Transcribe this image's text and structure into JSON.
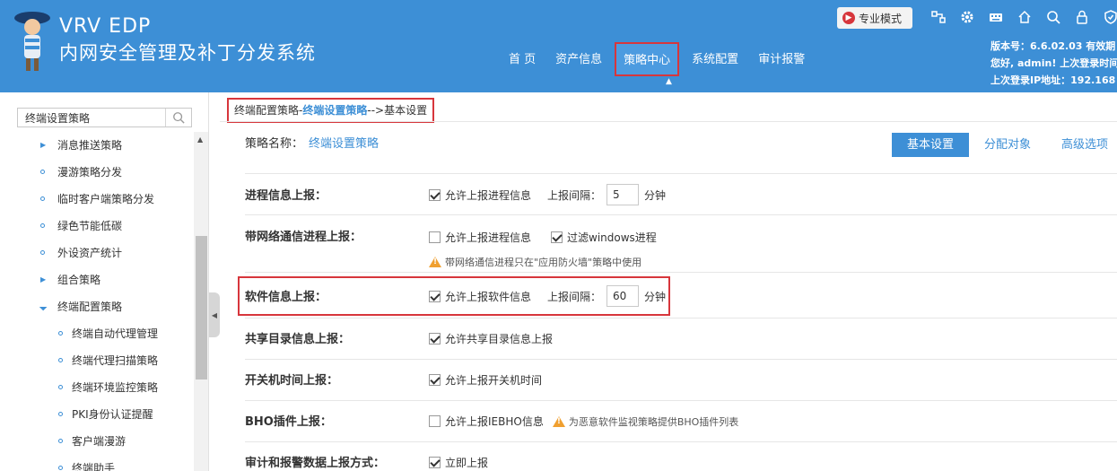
{
  "header": {
    "brand_line1": "VRV EDP",
    "brand_line2": "内网安全管理及补丁分发系统",
    "nav": [
      "首 页",
      "资产信息",
      "策略中心",
      "系统配置",
      "审计报警"
    ],
    "active_nav": "策略中心",
    "pro_mode_label": "专业模式",
    "icons": [
      "network-icon",
      "gear-icon",
      "keyboard-icon",
      "home-icon",
      "search-icon",
      "lock-icon",
      "shield-icon"
    ],
    "version_line": "版本号：6.6.02.03  有效期",
    "greeting_line": "您好, admin! 上次登录时间",
    "last_ip_line": "上次登录IP地址：192.168"
  },
  "sidebar": {
    "search_value": "终端设置策略",
    "items": [
      {
        "label": "消息推送策略",
        "marker": "arrow"
      },
      {
        "label": "漫游策略分发",
        "marker": "circle"
      },
      {
        "label": "临时客户端策略分发",
        "marker": "circle"
      },
      {
        "label": "绿色节能低碳",
        "marker": "circle"
      },
      {
        "label": "外设资产统计",
        "marker": "circle"
      },
      {
        "label": "组合策略",
        "marker": "arrow"
      },
      {
        "label": "终端配置策略",
        "marker": "open"
      },
      {
        "label": "终端自动代理管理",
        "marker": "circle"
      },
      {
        "label": "终端代理扫描策略",
        "marker": "circle"
      },
      {
        "label": "终端环境监控策略",
        "marker": "circle"
      },
      {
        "label": "PKI身份认证提醒",
        "marker": "circle"
      },
      {
        "label": "客户端漫游",
        "marker": "circle"
      },
      {
        "label": "终端助手",
        "marker": "circle"
      }
    ]
  },
  "breadcrumb": {
    "part1": "终端配置策略-",
    "current": "终端设置策略",
    "part3": "-->基本设置"
  },
  "policy": {
    "name_label": "策略名称：",
    "name_value": "终端设置策略"
  },
  "tabs": [
    "基本设置",
    "分配对象",
    "高级选项"
  ],
  "rows": {
    "process": {
      "label": "进程信息上报：",
      "checkbox": "允许上报进程信息",
      "checked": true,
      "interval_label": "上报间隔：",
      "interval_value": "5",
      "unit": "分钟"
    },
    "netproc": {
      "label": "带网络通信进程上报：",
      "checkbox1": "允许上报进程信息",
      "checked1": false,
      "checkbox2": "过滤windows进程",
      "checked2": true,
      "warning": "带网络通信进程只在\"应用防火墙\"策略中使用"
    },
    "software": {
      "label": "软件信息上报：",
      "checkbox": "允许上报软件信息",
      "checked": true,
      "interval_label": "上报间隔：",
      "interval_value": "60",
      "unit": "分钟"
    },
    "share": {
      "label": "共享目录信息上报：",
      "checkbox": "允许共享目录信息上报",
      "checked": true
    },
    "power": {
      "label": "开关机时间上报：",
      "checkbox": "允许上报开关机时间",
      "checked": true
    },
    "bho": {
      "label": "BHO插件上报：",
      "checkbox": "允许上报IEBHO信息",
      "checked": false,
      "warning": "为恶意软件监视策略提供BHO插件列表"
    },
    "audit": {
      "label": "审计和报警数据上报方式：",
      "checkbox": "立即上报",
      "checked": true
    }
  },
  "colors": {
    "brand_blue": "#3d8fd6",
    "highlight_red": "#d7363c",
    "warning_orange": "#f0a030"
  }
}
